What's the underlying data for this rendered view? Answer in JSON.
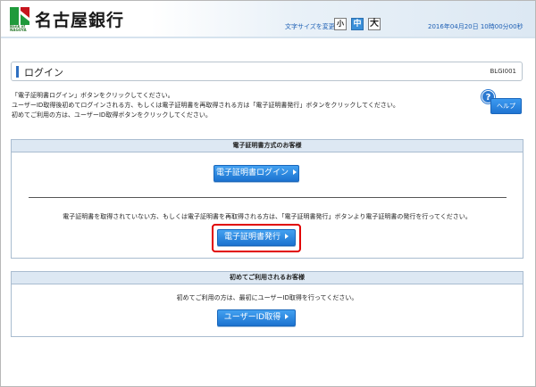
{
  "header": {
    "bank_name": "名古屋銀行",
    "logo_sub_text": "Bank of NAGOYA",
    "logo_icon": "bank-logo-icon",
    "font_size_label": "文字サイズを変更",
    "font_size_options": [
      "小",
      "中",
      "大"
    ],
    "datetime": "2016年04月20日 10時00分00秒"
  },
  "page": {
    "title": "ログイン",
    "screen_id": "BLGI001",
    "intro_lines": [
      "「電子証明書ログイン」ボタンをクリックしてください。",
      "ユーザーID取得後初めてログインされる方、もしくは電子証明書を再取得される方は「電子証明書発行」ボタンをクリックしてください。",
      "初めてご利用の方は、ユーザーID取得ボタンをクリックしてください。"
    ],
    "help_icon_text": "?",
    "help_label": "ヘルプ"
  },
  "cert_section": {
    "heading": "電子証明書方式のお客様",
    "login_button": "電子証明書ログイン",
    "issue_note": "電子証明書を取得されていない方、もしくは電子証明書を再取得される方は、「電子証明書発行」ボタンより電子証明書の発行を行ってください。",
    "issue_button": "電子証明書発行"
  },
  "new_user_section": {
    "heading": "初めてご利用されるお客様",
    "note": "初めてご利用の方は、最初にユーザーID取得を行ってください。",
    "uid_button": "ユーザーID取得"
  },
  "colors": {
    "accent_blue": "#1f74d2",
    "highlight_red": "#e10000",
    "panel_head": "#dde8f3"
  }
}
